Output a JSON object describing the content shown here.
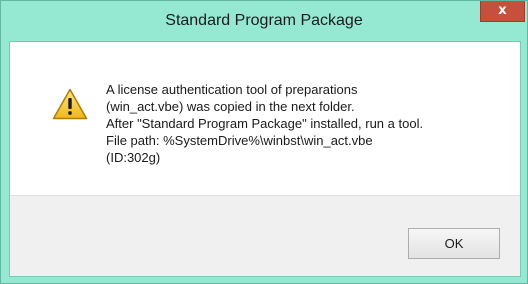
{
  "window": {
    "title": "Standard Program Package",
    "frame_color": "#95e8d2",
    "close_glyph": "x",
    "close_color": "#c7503c"
  },
  "message": {
    "icon": "warning-icon",
    "lines": [
      "A license authentication tool of preparations",
      "(win_act.vbe) was copied in the next folder.",
      "After \"Standard Program Package\" installed, run a tool.",
      "File path: %SystemDrive%\\winbst\\win_act.vbe",
      "(ID:302g)"
    ]
  },
  "buttons": {
    "ok_label": "OK"
  }
}
